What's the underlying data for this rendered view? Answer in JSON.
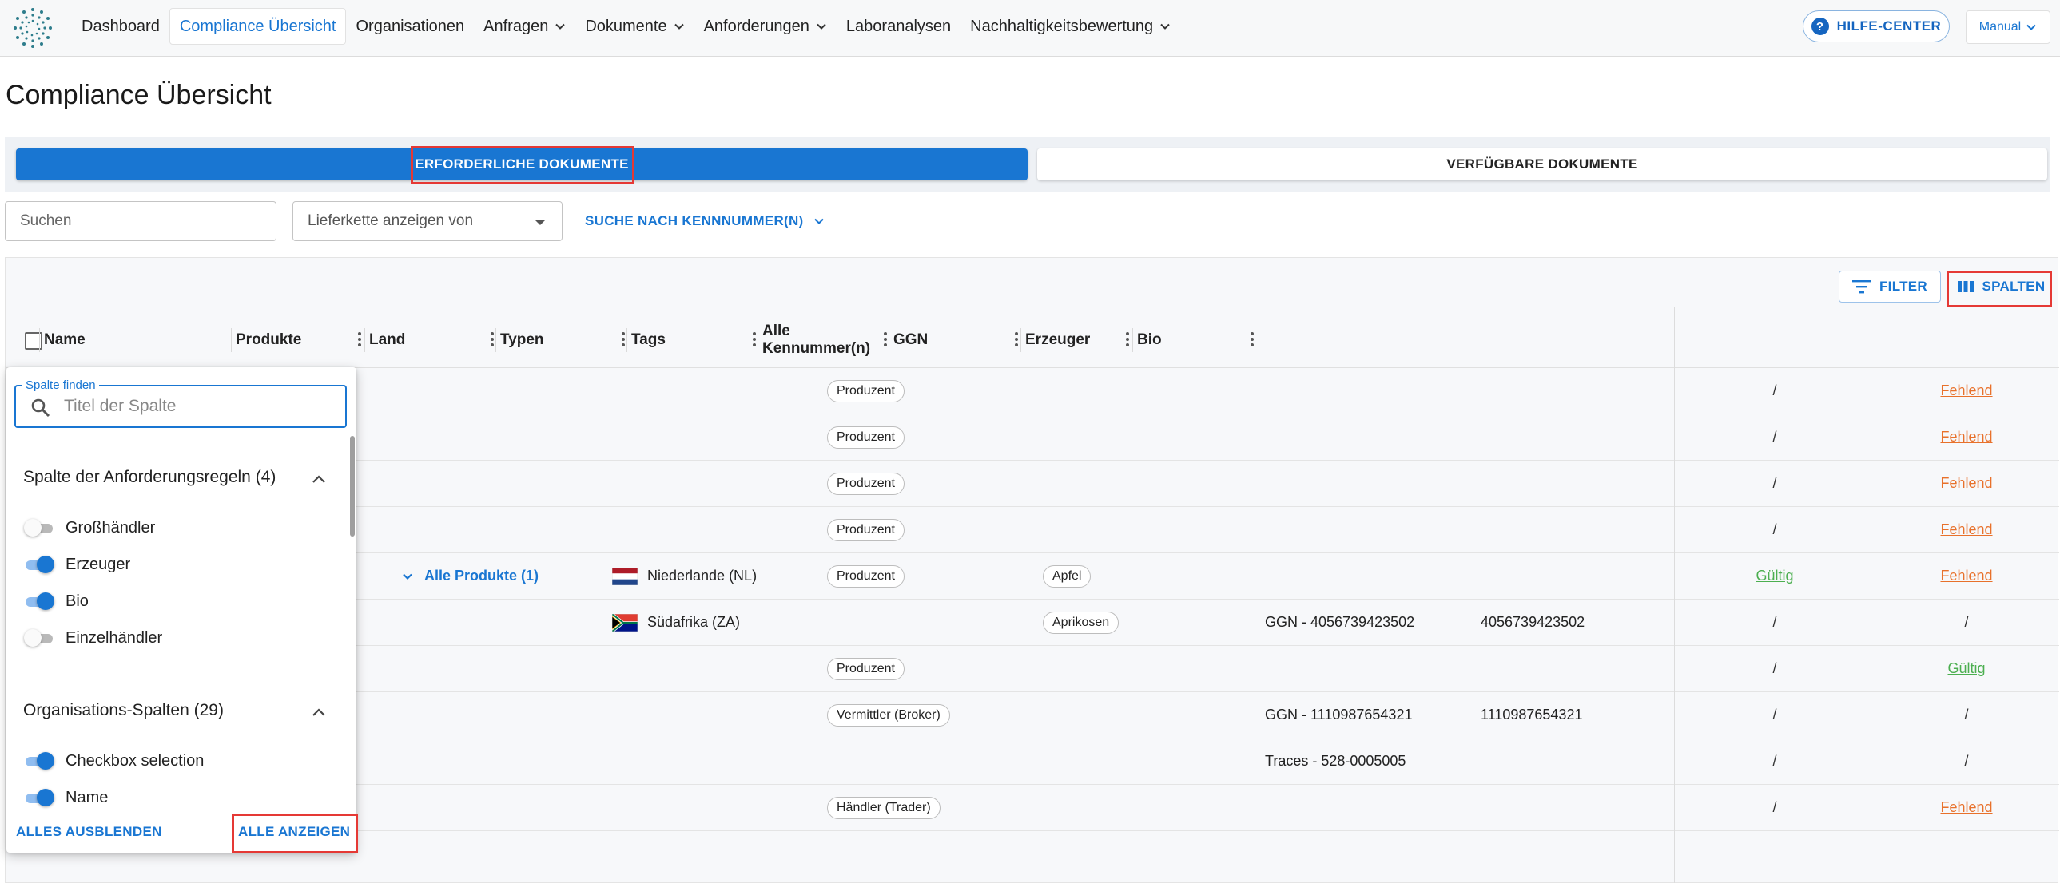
{
  "nav": {
    "items": [
      {
        "label": "Dashboard",
        "dropdown": false,
        "active": false
      },
      {
        "label": "Compliance Übersicht",
        "dropdown": false,
        "active": true
      },
      {
        "label": "Organisationen",
        "dropdown": false,
        "active": false
      },
      {
        "label": "Anfragen",
        "dropdown": true,
        "active": false
      },
      {
        "label": "Dokumente",
        "dropdown": true,
        "active": false
      },
      {
        "label": "Anforderungen",
        "dropdown": true,
        "active": false
      },
      {
        "label": "Laboranalysen",
        "dropdown": false,
        "active": false
      },
      {
        "label": "Nachhaltigkeitsbewertung",
        "dropdown": true,
        "active": false
      }
    ],
    "help_label": "HILFE-CENTER",
    "manual_label": "Manual"
  },
  "page": {
    "title": "Compliance Übersicht"
  },
  "tabs": {
    "required": "ERFORDERLICHE DOKUMENTE",
    "available": "VERFÜGBARE DOKUMENTE",
    "active": "required"
  },
  "search": {
    "placeholder": "Suchen",
    "supply_chain_placeholder": "Lieferkette anzeigen von",
    "id_search_label": "SUCHE NACH KENNNUMMER(N)"
  },
  "toolbar": {
    "filter_label": "FILTER",
    "columns_label": "SPALTEN"
  },
  "columns": [
    "Name",
    "Produkte",
    "Land",
    "Typen",
    "Tags",
    "Alle Kennummer(n)",
    "GGN",
    "Erzeuger",
    "Bio"
  ],
  "rows": [
    {
      "produkte": "",
      "land": "",
      "land_flag": "",
      "typ": "Produzent",
      "tag": "",
      "kennummer": "",
      "ggn": "",
      "erzeuger": "/",
      "erzeuger_status": "none",
      "bio": "Fehlend",
      "bio_status": "missing"
    },
    {
      "produkte": "",
      "land": "",
      "land_flag": "",
      "typ": "Produzent",
      "tag": "",
      "kennummer": "",
      "ggn": "",
      "erzeuger": "/",
      "erzeuger_status": "none",
      "bio": "Fehlend",
      "bio_status": "missing"
    },
    {
      "produkte": "",
      "land": "",
      "land_flag": "",
      "typ": "Produzent",
      "tag": "",
      "kennummer": "",
      "ggn": "",
      "erzeuger": "/",
      "erzeuger_status": "none",
      "bio": "Fehlend",
      "bio_status": "missing"
    },
    {
      "produkte": "",
      "land": "",
      "land_flag": "",
      "typ": "Produzent",
      "tag": "",
      "kennummer": "",
      "ggn": "",
      "erzeuger": "/",
      "erzeuger_status": "none",
      "bio": "Fehlend",
      "bio_status": "missing"
    },
    {
      "produkte": "Alle Produkte (1)",
      "land": "Niederlande (NL)",
      "land_flag": "nl",
      "typ": "Produzent",
      "tag": "Apfel",
      "kennummer": "",
      "ggn": "",
      "erzeuger": "Gültig",
      "erzeuger_status": "valid",
      "bio": "Fehlend",
      "bio_status": "missing"
    },
    {
      "produkte": "",
      "land": "Südafrika (ZA)",
      "land_flag": "za",
      "typ": "",
      "tag": "Aprikosen",
      "kennummer": "GGN - 4056739423502",
      "ggn": "4056739423502",
      "erzeuger": "/",
      "erzeuger_status": "none",
      "bio": "/",
      "bio_status": "none"
    },
    {
      "produkte": "",
      "land": "",
      "land_flag": "",
      "typ": "Produzent",
      "tag": "",
      "kennummer": "",
      "ggn": "",
      "erzeuger": "/",
      "erzeuger_status": "none",
      "bio": "Gültig",
      "bio_status": "valid"
    },
    {
      "produkte": "",
      "land": "",
      "land_flag": "",
      "typ": "Vermittler (Broker)",
      "tag": "",
      "kennummer": "GGN - 1110987654321",
      "ggn": "1110987654321",
      "erzeuger": "/",
      "erzeuger_status": "none",
      "bio": "/",
      "bio_status": "none"
    },
    {
      "produkte": "",
      "land": "",
      "land_flag": "",
      "typ": "",
      "tag": "",
      "kennummer": "Traces - 528-0005005",
      "ggn": "",
      "erzeuger": "/",
      "erzeuger_status": "none",
      "bio": "/",
      "bio_status": "none"
    },
    {
      "produkte": "",
      "land": "",
      "land_flag": "",
      "typ": "Händler (Trader)",
      "tag": "",
      "kennummer": "",
      "ggn": "",
      "erzeuger": "/",
      "erzeuger_status": "none",
      "bio": "Fehlend",
      "bio_status": "missing"
    }
  ],
  "column_panel": {
    "find_label": "Spalte finden",
    "find_placeholder": "Titel der Spalte",
    "section1": {
      "title": "Spalte der Anforderungsregeln (4)",
      "items": [
        {
          "label": "Großhändler",
          "on": false
        },
        {
          "label": "Erzeuger",
          "on": true
        },
        {
          "label": "Bio",
          "on": true
        },
        {
          "label": "Einzelhändler",
          "on": false
        }
      ]
    },
    "section2": {
      "title": "Organisations-Spalten (29)",
      "items": [
        {
          "label": "Checkbox selection",
          "on": true
        },
        {
          "label": "Name",
          "on": true
        }
      ]
    },
    "hide_all": "ALLES AUSBLENDEN",
    "show_all": "ALLE ANZEIGEN"
  },
  "colors": {
    "primary": "#1976d2",
    "missing": "#e8712b",
    "valid": "#4caf50",
    "highlight": "#e53935"
  }
}
